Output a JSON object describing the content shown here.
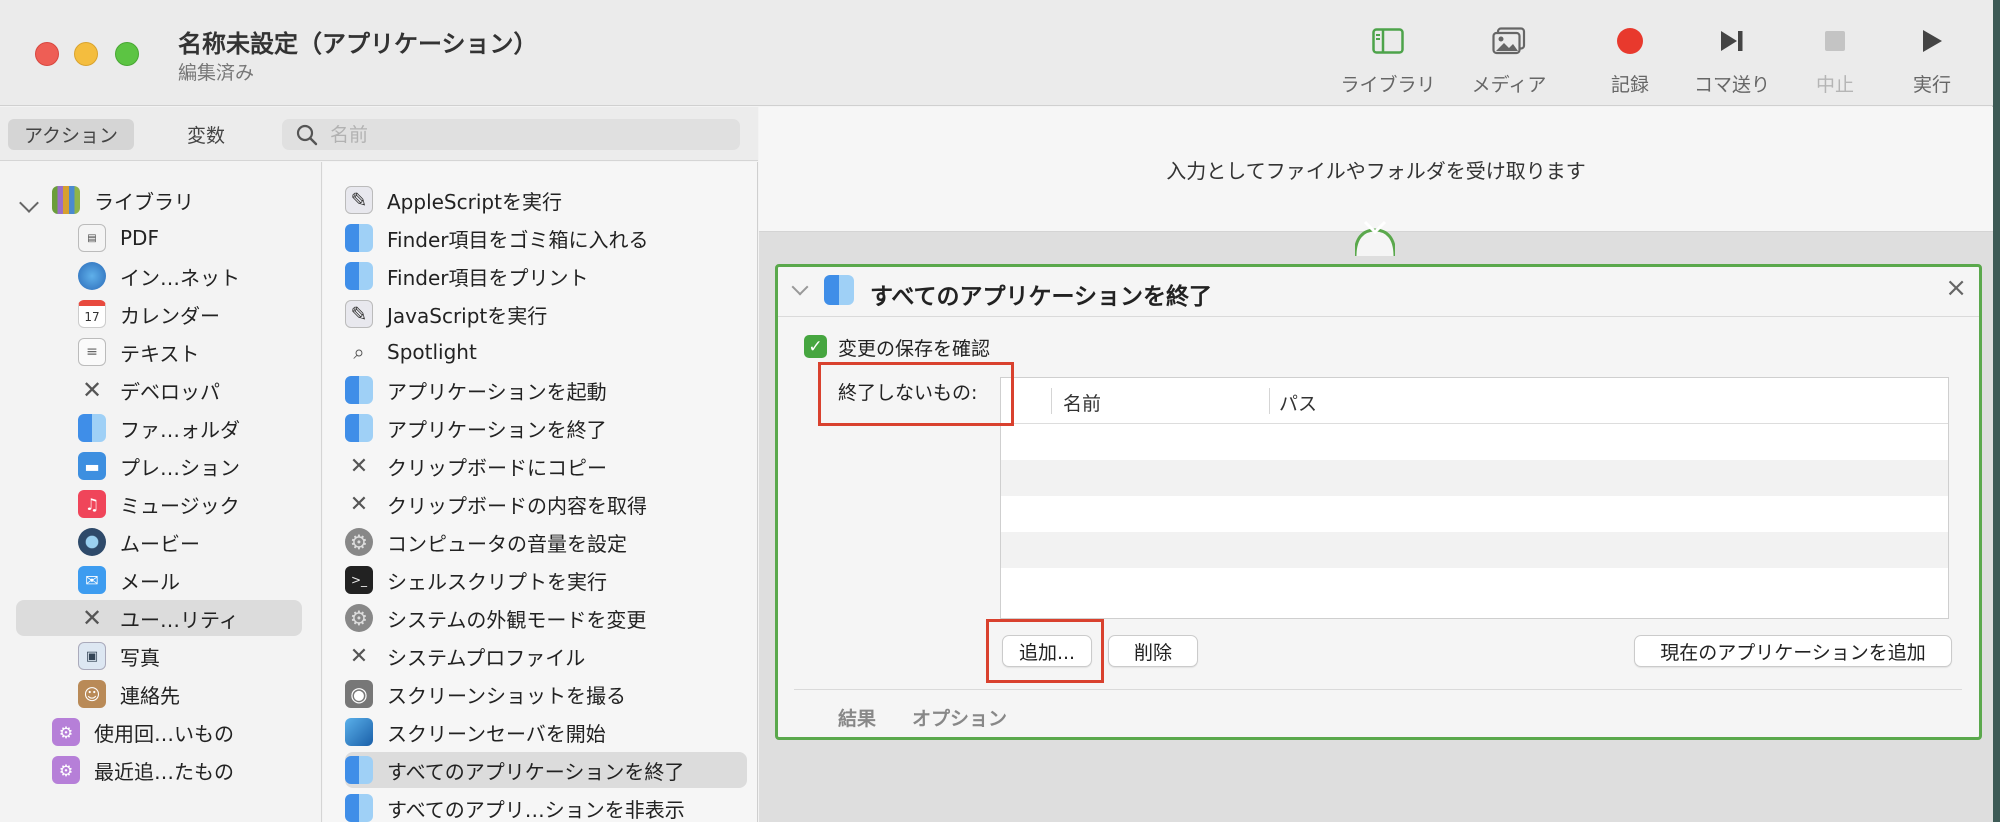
{
  "window": {
    "title": "名称未設定（アプリケーション）",
    "subtitle": "編集済み"
  },
  "toolbar": {
    "library": "ライブラリ",
    "media": "メディア",
    "record": "記録",
    "step": "コマ送り",
    "stop": "中止",
    "run": "実行"
  },
  "sidebar": {
    "tabs": {
      "actions": "アクション",
      "variables": "変数"
    },
    "search_placeholder": "名前",
    "library_root": "ライブラリ",
    "library_items": [
      "PDF",
      "イン…ネット",
      "カレンダー",
      "テキスト",
      "デベロッパ",
      "ファ…ォルダ",
      "プレ…ション",
      "ミュージック",
      "ムービー",
      "メール",
      "ユー…リティ",
      "写真",
      "連絡先"
    ],
    "smart_groups": [
      "使用回…いもの",
      "最近追…たもの"
    ]
  },
  "actions_list": [
    "AppleScriptを実行",
    "Finder項目をゴミ箱に入れる",
    "Finder項目をプリント",
    "JavaScriptを実行",
    "Spotlight",
    "アプリケーションを起動",
    "アプリケーションを終了",
    "クリップボードにコピー",
    "クリップボードの内容を取得",
    "コンピュータの音量を設定",
    "シェルスクリプトを実行",
    "システムの外観モードを変更",
    "システムプロファイル",
    "スクリーンショットを撮る",
    "スクリーンセーバを開始",
    "すべてのアプリケーションを終了",
    "すべてのアプリ…ションを非表示"
  ],
  "workflow": {
    "input_description": "入力としてファイルやフォルダを受け取ります",
    "action": {
      "title": "すべてのアプリケーションを終了",
      "close_glyph": "×",
      "checkbox_label": "変更の保存を確認",
      "checkbox_checked": true,
      "exclude_label": "終了しないもの:",
      "table_headers": [
        "名前",
        "パス"
      ],
      "buttons": {
        "add": "追加...",
        "remove": "削除",
        "add_current": "現在のアプリケーションを追加"
      },
      "footer_tabs": [
        "結果",
        "オプション"
      ]
    }
  },
  "colors": {
    "accent_green": "#5aa84c",
    "annotation_red": "#d9412e",
    "record_red": "#e8392d"
  }
}
